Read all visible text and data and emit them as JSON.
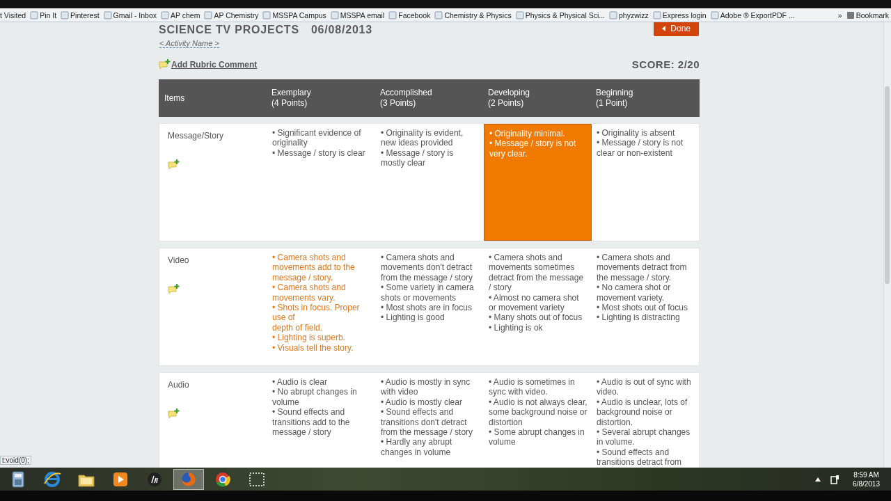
{
  "bookmarks_bar": {
    "items": [
      "t Visited",
      "Pin It",
      "Pinterest",
      "Gmail - Inbox",
      "AP chem",
      "AP Chemistry",
      "MSSPA Campus",
      "MSSPA email",
      "Facebook",
      "Chemistry & Physics",
      "Physics & Physical Sci...",
      "phyzwizz",
      "Express login",
      "Adobe ® ExportPDF ..."
    ],
    "overflow": "»",
    "folder": "Bookmark"
  },
  "header": {
    "title": "SCIENCE TV PROJECTS",
    "date": "06/08/2013",
    "activity": "< Activity Name >",
    "done": "Done",
    "add_comment": "Add Rubric Comment",
    "score": "SCORE: 2/20"
  },
  "table": {
    "item_heading": "Items",
    "levels": [
      {
        "name": "Exemplary",
        "points": "(4 Points)"
      },
      {
        "name": "Accomplished",
        "points": "(3 Points)"
      },
      {
        "name": "Developing",
        "points": "(2 Points)"
      },
      {
        "name": "Beginning",
        "points": "(1 Point)"
      }
    ],
    "rows": [
      {
        "item": "Message/Story",
        "cells": [
          {
            "lines": [
              "• Significant evidence of originality",
              "• Message / story is clear"
            ],
            "selected": false,
            "highlighted": false
          },
          {
            "lines": [
              "• Originality is evident, new ideas provided",
              "• Message / story is mostly clear"
            ],
            "selected": false,
            "highlighted": false
          },
          {
            "lines": [
              "• Originality minimal.",
              "• Message / story is not very clear."
            ],
            "selected": true,
            "highlighted": false
          },
          {
            "lines": [
              "• Originality is absent",
              "• Message / story is not clear or non-existent"
            ],
            "selected": false,
            "highlighted": false
          }
        ]
      },
      {
        "item": "Video",
        "cells": [
          {
            "lines": [
              "• Camera shots and movements add to the message / story.",
              "• Camera shots and movements vary.",
              "• Shots in focus. Proper use of\ndepth of field.",
              "• Lighting is superb.",
              "• Visuals tell the story."
            ],
            "selected": false,
            "highlighted": true
          },
          {
            "lines": [
              "• Camera shots and movements don't detract from the message / story",
              "• Some variety in camera shots or movements",
              "• Most shots are in focus",
              "• Lighting is good"
            ],
            "selected": false,
            "highlighted": false
          },
          {
            "lines": [
              "• Camera shots and movements sometimes detract from the message / story",
              "• Almost no camera shot or movement variety",
              "• Many shots out of focus",
              "• Lighting is ok"
            ],
            "selected": false,
            "highlighted": false
          },
          {
            "lines": [
              "• Camera shots and movements detract from the message / story.",
              "• No camera shot or movement variety.",
              "• Most shots out of focus",
              "• Lighting is distracting"
            ],
            "selected": false,
            "highlighted": false
          }
        ]
      },
      {
        "item": "Audio",
        "cells": [
          {
            "lines": [
              "• Audio is clear",
              "• No abrupt changes in volume",
              "• Sound effects and transitions add to the message / story"
            ],
            "selected": false,
            "highlighted": false
          },
          {
            "lines": [
              "• Audio is mostly in sync with video",
              "• Audio is mostly clear",
              "• Sound effects and transitions don't detract from the message / story",
              "• Hardly any abrupt changes in volume"
            ],
            "selected": false,
            "highlighted": false
          },
          {
            "lines": [
              "• Audio is sometimes in sync with video.",
              "• Audio is not always clear, some background noise or distortion",
              "• Some abrupt changes in volume"
            ],
            "selected": false,
            "highlighted": false
          },
          {
            "lines": [
              "• Audio is out of sync with video.",
              "• Audio is unclear, lots of background noise or distortion.",
              "• Several abrupt changes in volume.",
              "• Sound effects and transitions detract from"
            ],
            "selected": false,
            "highlighted": false
          }
        ]
      }
    ]
  },
  "status_text": "t:void(0);",
  "taskbar": {
    "apps": [
      {
        "kind": "calculator",
        "selected": false
      },
      {
        "kind": "ie",
        "selected": false
      },
      {
        "kind": "folder",
        "selected": false
      },
      {
        "kind": "media",
        "selected": false
      },
      {
        "kind": "hp",
        "selected": false
      },
      {
        "kind": "firefox",
        "selected": true
      },
      {
        "kind": "chrome",
        "selected": false
      },
      {
        "kind": "snip",
        "selected": false
      }
    ],
    "time": "8:59 AM",
    "date": "6/8/2013"
  }
}
